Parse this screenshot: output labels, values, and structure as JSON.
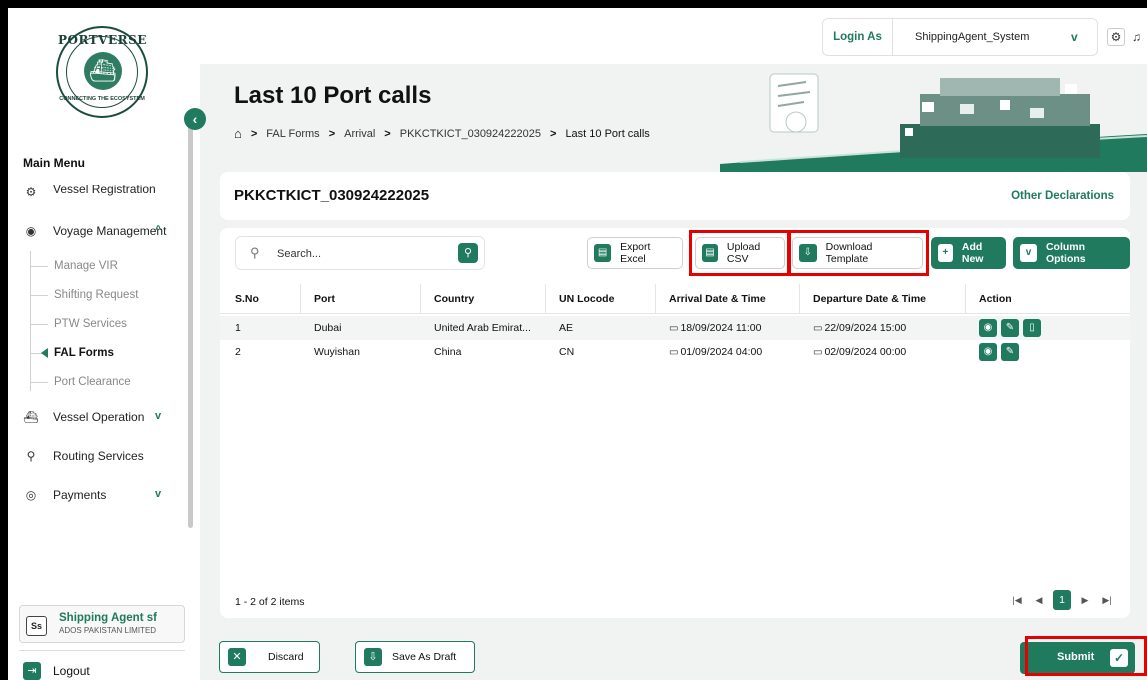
{
  "sidebar": {
    "logo_top": "PORTVERSE",
    "logo_bottom": "CONNECTING THE ECOSYSTEM",
    "main_menu_label": "Main Menu",
    "items": [
      {
        "label": "Vessel Registration",
        "icon": "ship-wheel-icon"
      },
      {
        "label": "Voyage Management",
        "icon": "location-pin-icon"
      },
      {
        "label": "Vessel Operation",
        "icon": "vessel-icon"
      },
      {
        "label": "Routing Services",
        "icon": "route-icon"
      },
      {
        "label": "Payments",
        "icon": "payment-icon"
      }
    ],
    "sub_items": [
      "Manage VIR",
      "Shifting Request",
      "PTW Services",
      "FAL Forms",
      "Port Clearance"
    ],
    "active_sub_item": "FAL Forms",
    "user": {
      "initials": "Ss",
      "name": "Shipping Agent sf",
      "org": "ADOS PAKISTAN LIMITED"
    },
    "logout_label": "Logout"
  },
  "topbar": {
    "login_label": "Login As",
    "login_value": "ShippingAgent_System"
  },
  "hero": {
    "title": "Last 10 Port calls",
    "breadcrumb": [
      "FAL Forms",
      "Arrival",
      "PKKCTKICT_030924222025",
      "Last 10 Port calls"
    ]
  },
  "declaration": {
    "voyage_id": "PKKCTKICT_030924222025",
    "other_link": "Other Declarations"
  },
  "toolbar": {
    "search_placeholder": "Search...",
    "export_excel": "Export Excel",
    "upload_csv": "Upload CSV",
    "download_template": "Download Template",
    "add_new": "Add New",
    "column_options": "Column Options"
  },
  "table": {
    "columns": [
      "S.No",
      "Port",
      "Country",
      "UN Locode",
      "Arrival Date & Time",
      "Departure Date & Time",
      "Action"
    ],
    "rows": [
      {
        "sno": "1",
        "port": "Dubai",
        "country": "United Arab Emirat...",
        "locode": "AE",
        "arrival": "18/09/2024 11:00",
        "departure": "22/09/2024 15:00"
      },
      {
        "sno": "2",
        "port": "Wuyishan",
        "country": "China",
        "locode": "CN",
        "arrival": "01/09/2024 04:00",
        "departure": "02/09/2024 00:00"
      }
    ]
  },
  "pagination": {
    "summary": "1 - 2 of 2 items",
    "current_page": "1"
  },
  "footer": {
    "discard": "Discard",
    "save_draft": "Save As Draft",
    "submit": "Submit"
  },
  "colors": {
    "accent": "#1f7a5e",
    "highlight": "#e60000"
  }
}
